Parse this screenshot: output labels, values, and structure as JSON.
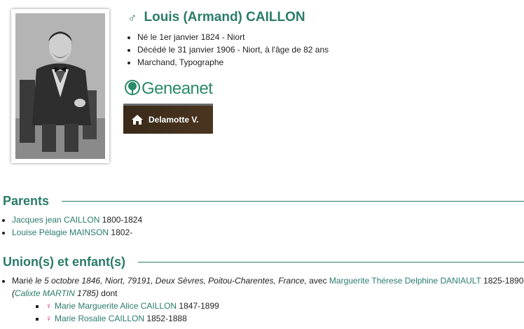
{
  "person": {
    "sex_symbol": "♂",
    "name": "Louis (Armand) CAILLON",
    "facts": [
      "Né le 1er janvier 1824 - Niort",
      "Décédé le 31 janvier 1906 - Niort, à l'âge de 82 ans",
      "Marchand, Typographe"
    ]
  },
  "brand": {
    "logo_text": "Geneanet",
    "owner_label": "Delamotte V."
  },
  "parents": {
    "title": "Parents",
    "items": [
      {
        "name": "Jacques jean CAILLON",
        "dates": "1800-1824"
      },
      {
        "name": "Louise Pélagie MAINSON",
        "dates": "1802-"
      }
    ]
  },
  "unions": {
    "title": "Union(s) et enfant(s)",
    "marriage": {
      "prefix": "Marié ",
      "date_place": "le 5 octobre 1846, Niort, 79191, Deux Sèvres, Poitou-Charentes, France,",
      "with": " avec ",
      "spouse": "Marguerite Thérese Delphine DANIAULT",
      "spouse_dates": " 1825-1890",
      "paren_open": "(",
      "spouse_parent": "Calixte MARTIN",
      "spouse_parent_date": " 1785)",
      "dont": " dont"
    },
    "children": [
      {
        "sex_symbol": "♀",
        "name": "Marie Marguerite Alice CAILLON",
        "dates": "1847-1899"
      },
      {
        "sex_symbol": "♀",
        "name": "Marie Rosalie CAILLON",
        "dates": "1852-1888"
      }
    ]
  },
  "colors": {
    "accent": "#2a7b6a",
    "female": "#d12a6a"
  }
}
